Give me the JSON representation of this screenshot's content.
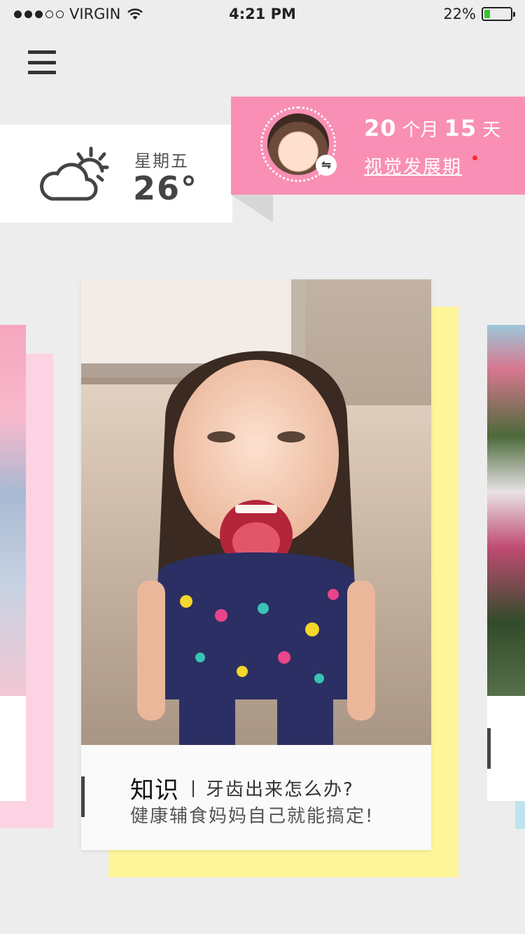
{
  "status_bar": {
    "carrier": "VIRGIN",
    "time": "4:21 PM",
    "battery_percent": "22%",
    "battery_level": 0.22,
    "signal_bars_filled": 3,
    "signal_bars_total": 5
  },
  "weather": {
    "icon": "partly-cloudy-icon",
    "weekday": "星期五",
    "temperature": "26°"
  },
  "baby": {
    "months": "20",
    "months_unit": "个月",
    "days": "15",
    "days_unit": "天",
    "stage": "视觉发展期",
    "swap_icon": "⇋"
  },
  "featured_card": {
    "category": "知识",
    "separator": "|",
    "headline": "牙齿出来怎么办?",
    "subline": "健康辅食妈妈自己就能搞定!"
  },
  "colors": {
    "accent_pink": "#f98fb4",
    "card_yellow": "#fdf59a",
    "side_pink": "#fbd3e2",
    "side_blue": "#bfe3ee",
    "battery_green": "#3ac430"
  }
}
